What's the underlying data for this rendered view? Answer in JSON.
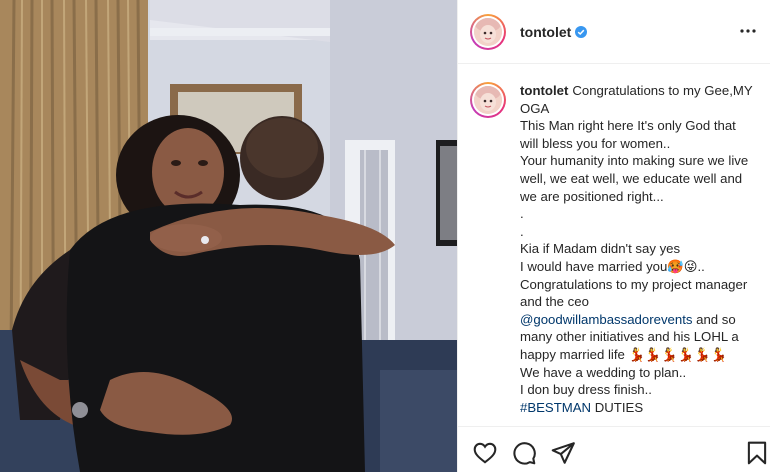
{
  "post": {
    "username": "tontolet",
    "verified": true,
    "more_icon": "more-options-icon"
  },
  "caption": {
    "username": "tontolet",
    "line1": "Congratulations to my Gee,MY OGA",
    "line2": "This Man right here It's only God that will bless you for women..",
    "line3": "Your humanity into making sure we live well, we eat well, we educate well and we are positioned right...",
    "line4": ".",
    "line5": ".",
    "line6": "Kia if Madam didn't say yes",
    "line7_pre": "I would have married you",
    "line7_emoji": "🥵😜..",
    "line8": "Congratulations to my project manager and the ceo",
    "mention": "@goodwillambassadorevents",
    "line9": " and so many other initiatives and his LOHL a happy married life ",
    "line9_emoji": "💃💃💃💃💃💃",
    "line10": "We have a wedding to plan..",
    "line11": "I don buy dress finish..",
    "hashtag": "#BESTMAN",
    "line12_rest": " DUTIES"
  },
  "actions": {
    "like": "heart-icon",
    "comment": "comment-icon",
    "share": "share-icon",
    "save": "bookmark-icon"
  },
  "colors": {
    "link": "#00376b",
    "verified": "#3897f0",
    "border": "#efefef"
  }
}
